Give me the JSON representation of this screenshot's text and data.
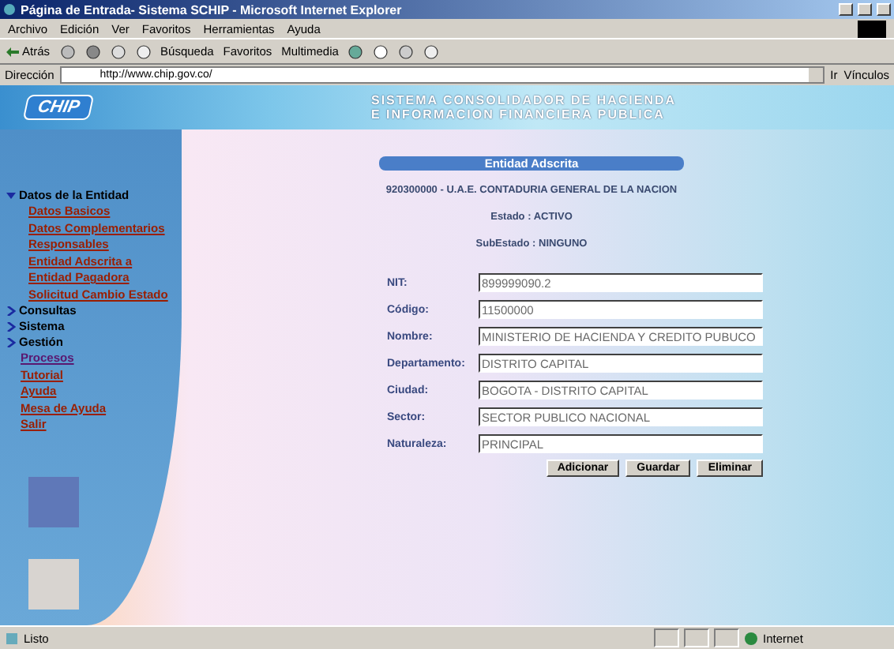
{
  "window": {
    "title": "Página de Entrada- Sistema SCHIP - Microsoft Internet Explorer"
  },
  "menu": [
    "Archivo",
    "Edición",
    "Ver",
    "Favoritos",
    "Herramientas",
    "Ayuda"
  ],
  "toolbar": {
    "back": "Atrás",
    "search": "Búsqueda",
    "favorites": "Favoritos",
    "media": "Multimedia"
  },
  "address": {
    "label": "Dirección",
    "value": "http://www.chip.gov.co/",
    "go": "Ir",
    "links": "Vínculos"
  },
  "banner": {
    "logo": "CHIP",
    "lines": [
      "SISTEMA CONSOLIDADOR DE HACIENDA",
      "E INFORMACION FINANCIERA PUBLICA"
    ]
  },
  "sidebar": [
    {
      "kind": "section",
      "label": "Datos de la Entidad",
      "expanded": true,
      "children": [
        {
          "label": "Datos Basicos"
        },
        {
          "label": "Datos Complementarios"
        },
        {
          "label": "Responsables"
        },
        {
          "label": "Entidad Adscrita a"
        },
        {
          "label": "Entidad Pagadora"
        },
        {
          "label": "Solicitud Cambio Estado"
        }
      ]
    },
    {
      "kind": "section",
      "label": "Consultas",
      "expanded": false
    },
    {
      "kind": "section",
      "label": "Sistema",
      "expanded": false
    },
    {
      "kind": "section",
      "label": "Gestión",
      "expanded": false
    },
    {
      "kind": "link",
      "label": "Procesos",
      "visited": true
    },
    {
      "kind": "link",
      "label": "Tutorial",
      "visited": false
    },
    {
      "kind": "link",
      "label": "Ayuda",
      "visited": false
    },
    {
      "kind": "link",
      "label": "Mesa de Ayuda",
      "visited": false
    },
    {
      "kind": "link",
      "label": "Salir",
      "visited": false
    }
  ],
  "panel": {
    "title": "Entidad Adscrita",
    "entity": "920300000 - U.A.E. CONTADURIA GENERAL DE LA NACION",
    "status": "Estado : ACTIVO",
    "substatus": "SubEstado : NINGUNO"
  },
  "fields": [
    {
      "label": "NIT:",
      "value": "899999090.2"
    },
    {
      "label": "Código:",
      "value": "11500000"
    },
    {
      "label": "Nombre:",
      "value": "MINISTERIO DE HACIENDA Y CREDITO PUBUCO"
    },
    {
      "label": "Departamento:",
      "value": "DISTRITO CAPITAL"
    },
    {
      "label": "Ciudad:",
      "value": "BOGOTA - DISTRITO CAPITAL"
    },
    {
      "label": "Sector:",
      "value": "SECTOR PUBLICO NACIONAL"
    },
    {
      "label": "Naturaleza:",
      "value": "PRINCIPAL"
    }
  ],
  "buttons": [
    "Adicionar",
    "Guardar",
    "Eliminar"
  ],
  "status_bar": {
    "text": "Listo",
    "zone": "Internet"
  }
}
